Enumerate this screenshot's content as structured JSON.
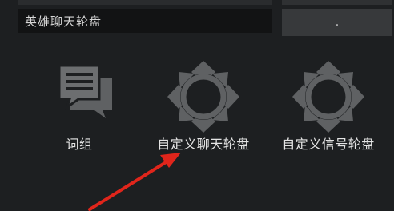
{
  "setting": {
    "label": "英雄聊天轮盘",
    "value": "."
  },
  "options": [
    {
      "label": "词组",
      "icon": "chat-bubbles-icon"
    },
    {
      "label": "自定义聊天轮盘",
      "icon": "wheel-icon"
    },
    {
      "label": "自定义信号轮盘",
      "icon": "wheel-icon"
    }
  ],
  "colors": {
    "background": "#1d1f21",
    "icon": "#5f6163",
    "arrow": "#e0251b"
  }
}
